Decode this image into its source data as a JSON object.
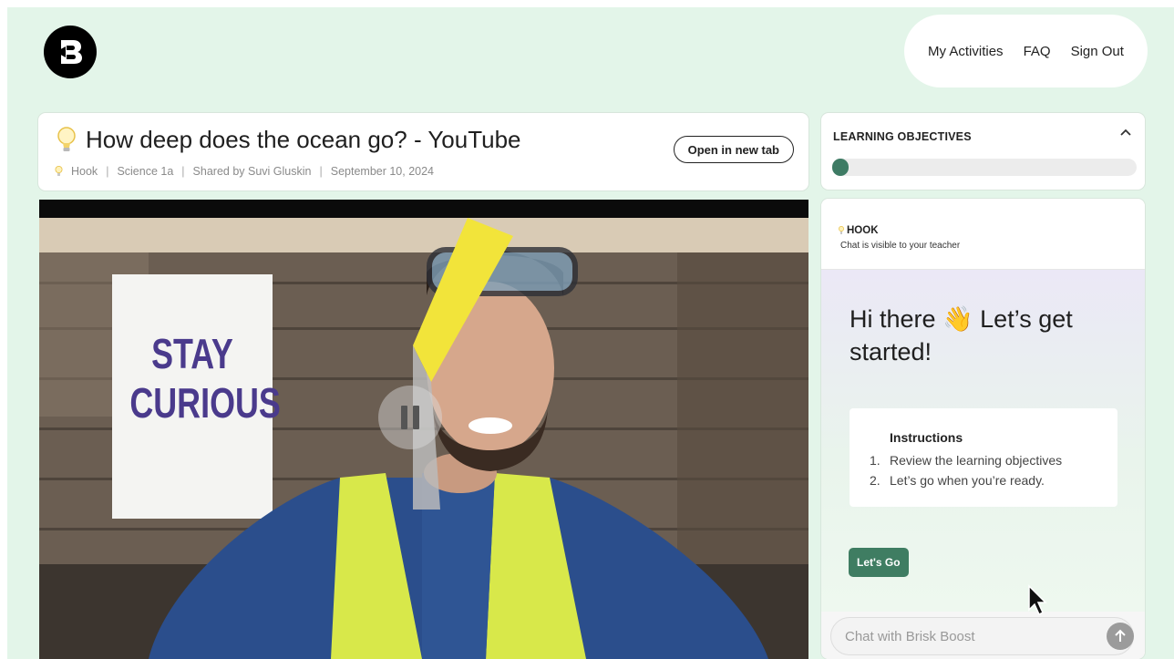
{
  "brand": {
    "logo_letter": "B"
  },
  "nav": {
    "items": [
      "My Activities",
      "FAQ",
      "Sign Out"
    ]
  },
  "resource": {
    "title": "How deep does the ocean go? - YouTube",
    "meta": [
      "Hook",
      "Science 1a",
      "Shared by Suvi Gluskin",
      "September 10, 2024"
    ],
    "open_button": "Open in new tab"
  },
  "video": {
    "poster_lines": [
      "STAY",
      "CURIOUS"
    ],
    "state": "playing"
  },
  "objectives": {
    "title": "LEARNING OBJECTIVES",
    "progress": 0.05
  },
  "chat": {
    "hook_label": "HOOK",
    "visibility_note": "Chat is visible to your teacher",
    "greeting": "Hi there 👋 Let’s get started!",
    "instructions": {
      "title": "Instructions",
      "steps": [
        {
          "num": "1.",
          "text": "Review the learning objectives"
        },
        {
          "num": "2.",
          "text": "Let’s go when you’re ready."
        }
      ]
    },
    "go_button": "Let's Go",
    "input_placeholder": "Chat with Brisk Boost"
  },
  "colors": {
    "accent": "#3f7d62",
    "background": "#e3f5e9"
  }
}
